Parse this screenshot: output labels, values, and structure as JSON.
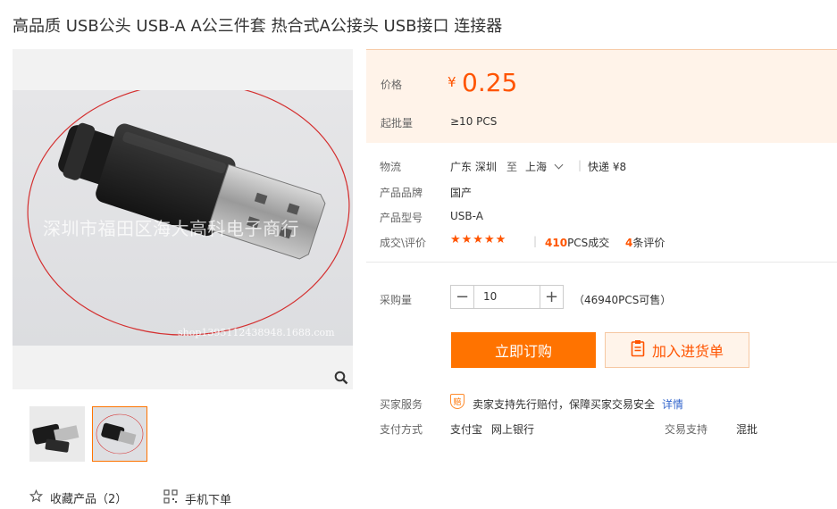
{
  "product": {
    "title": "高品质 USB公头 USB-A A公三件套 热合式A公接头 USB接口 连接器",
    "watermark": "深圳市福田区海大高科电子商行",
    "watermark_url": "shop1395112438948.1688.com"
  },
  "price": {
    "label": "价格",
    "symbol": "¥",
    "value": "0.25",
    "min_label": "起批量",
    "min_value": "≥10  PCS"
  },
  "logistics": {
    "label": "物流",
    "from": "广东 深圳",
    "to_word": "至",
    "to": "上海",
    "sep": "|",
    "express": "快递 ¥8"
  },
  "brand": {
    "label": "产品品牌",
    "value": "国产"
  },
  "model": {
    "label": "产品型号",
    "value": "USB-A"
  },
  "rating": {
    "label": "成交\\评价",
    "stars": "★★★★★",
    "sep": "|",
    "sold_num": "410",
    "sold_unit": "PCS成交",
    "review_num": "4",
    "review_unit": "条评价"
  },
  "purchase": {
    "label": "采购量",
    "minus": "−",
    "plus": "+",
    "quantity": "10",
    "stock": "（46940PCS可售）"
  },
  "buttons": {
    "buy": "立即订购",
    "cart": "加入进货单"
  },
  "service": {
    "label": "买家服务",
    "badge": "赔",
    "text": "卖家支持先行赔付，保障买家交易安全",
    "link": "详情"
  },
  "payment": {
    "label": "支付方式",
    "methods": [
      "支付宝",
      "网上银行"
    ],
    "trade_label": "交易支持",
    "trade_value": "混批"
  },
  "footer": {
    "favorite": "收藏产品（2）",
    "mobile": "手机下单"
  },
  "colors": {
    "accent": "#ff7300",
    "price": "#ff5400",
    "link": "#3366cc",
    "price_bg": "#fff3e9"
  }
}
